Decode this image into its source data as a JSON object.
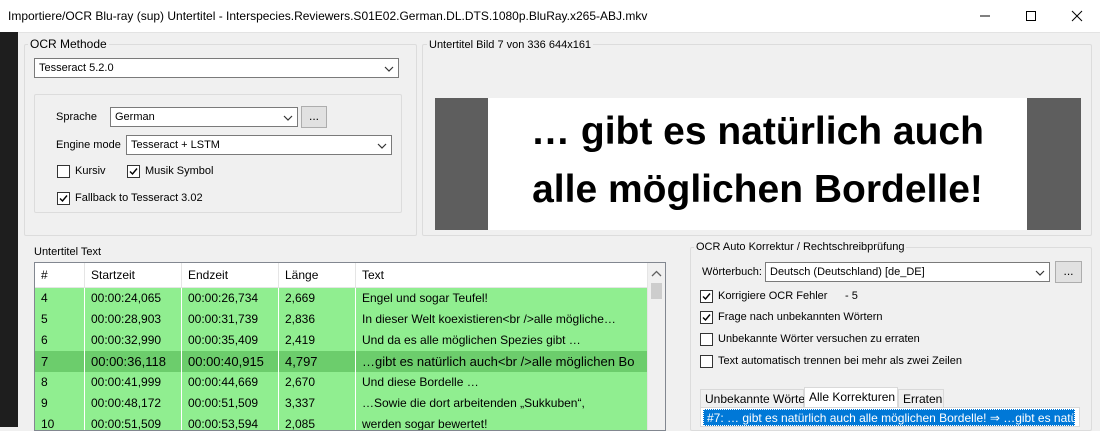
{
  "window": {
    "title": "Importiere/OCR Blu-ray (sup) Untertitel - Interspecies.Reviewers.S01E02.German.DL.DTS.1080p.BluRay.x265-ABJ.mkv"
  },
  "ocr": {
    "group_label": "OCR Methode",
    "method_value": "Tesseract 5.2.0",
    "language_label": "Sprache",
    "language_value": "German",
    "browse_label": "...",
    "engine_label": "Engine mode",
    "engine_value": "Tesseract + LSTM",
    "italic_label": "Kursiv",
    "italic_checked": false,
    "music_label": "Musik Symbol",
    "music_checked": true,
    "fallback_label": "Fallback to Tesseract 3.02",
    "fallback_checked": true
  },
  "preview": {
    "label": "Untertitel Bild 7 von 336   644x161",
    "line1": "… gibt es natürlich auch",
    "line2": "alle möglichen Bordelle!"
  },
  "subtitles": {
    "group_label": "Untertitel Text",
    "columns": [
      "#",
      "Startzeit",
      "Endzeit",
      "Länge",
      "Text"
    ],
    "rows": [
      [
        "4",
        "00:00:24,065",
        "00:00:26,734",
        "2,669",
        "Engel und sogar Teufel!"
      ],
      [
        "5",
        "00:00:28,903",
        "00:00:31,739",
        "2,836",
        "In dieser Welt koexistieren<br />alle mögliche…"
      ],
      [
        "6",
        "00:00:32,990",
        "00:00:35,409",
        "2,419",
        "Und da es alle möglichen Spezies gibt …"
      ],
      [
        "7",
        "00:00:36,118",
        "00:00:40,915",
        "4,797",
        "…gibt es natürlich auch<br />alle möglichen Bo"
      ],
      [
        "8",
        "00:00:41,999",
        "00:00:44,669",
        "2,670",
        "Und diese Bordelle …"
      ],
      [
        "9",
        "00:00:48,172",
        "00:00:51,509",
        "3,337",
        "…Sowie die dort arbeitenden „Sukkuben“,"
      ],
      [
        "10",
        "00:00:51,509",
        "00:00:53,594",
        "2,085",
        "werden sogar bewertet!"
      ]
    ],
    "selected_row": 3
  },
  "autocorrect": {
    "group_label": "OCR Auto Korrektur / Rechtschreibprüfung",
    "dictionary_label": "Wörterbuch:",
    "dictionary_value": "Deutsch (Deutschland) [de_DE]",
    "browse_label": "...",
    "fix_ocr_label": "Korrigiere OCR Fehler",
    "fix_ocr_count": "- 5",
    "fix_ocr_checked": true,
    "ask_unknown_label": "Frage nach unbekannten Wörtern",
    "ask_unknown_checked": true,
    "guess_unknown_label": "Unbekannte Wörter versuchen zu erraten",
    "guess_unknown_checked": false,
    "auto_break_label": "Text automatisch trennen bei mehr als zwei Zeilen",
    "auto_break_checked": false,
    "tabs": [
      "Unbekannte Wörter",
      "Alle Korrekturen",
      "Erraten"
    ],
    "active_tab": 1,
    "correction_item": "#7: … gibt es natürlich auch alle möglichen Bordelle! ⇒ …gibt es natürlich au"
  },
  "colors": {
    "row_green": "#90ee90",
    "row_selected": "#6ccd6c",
    "accent": "#0078d7"
  }
}
